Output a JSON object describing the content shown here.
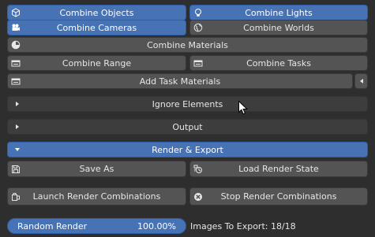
{
  "buttons": {
    "combine_objects": "Combine Objects",
    "combine_lights": "Combine Lights",
    "combine_cameras": "Combine Cameras",
    "combine_worlds": "Combine Worlds",
    "combine_materials": "Combine Materials",
    "combine_range": "Combine Range",
    "combine_tasks": "Combine Tasks",
    "add_task_materials": "Add Task Materials",
    "save_as": "Save As",
    "load_render_state": "Load Render State",
    "launch_render_combinations": "Launch Render Combinations",
    "stop_render_combinations": "Stop Render Combinations"
  },
  "sections": {
    "ignore_elements": "Ignore Elements",
    "output": "Output",
    "render_export": "Render & Export"
  },
  "random_render": {
    "label": "Random Render",
    "value_text": "100.00%",
    "fraction": 1.0
  },
  "images_to_export": "Images To Export: 18/18",
  "colors": {
    "accent": "#4772b3",
    "button": "#545454",
    "background": "#2e2e2e",
    "panel_header": "#3d3d3d"
  },
  "icons": {
    "combine_objects": "cube-icon",
    "combine_lights": "lightbulb-icon",
    "combine_cameras": "camera-icon",
    "combine_worlds": "globe-icon",
    "combine_materials": "material-sphere-icon",
    "combine_range": "range-icon",
    "combine_tasks": "task-icon",
    "add_task_materials": "task-add-icon",
    "save_as": "save-icon",
    "load_render_state": "load-state-icon",
    "launch_render_combinations": "launch-icon",
    "stop_render_combinations": "stop-circle-icon"
  }
}
